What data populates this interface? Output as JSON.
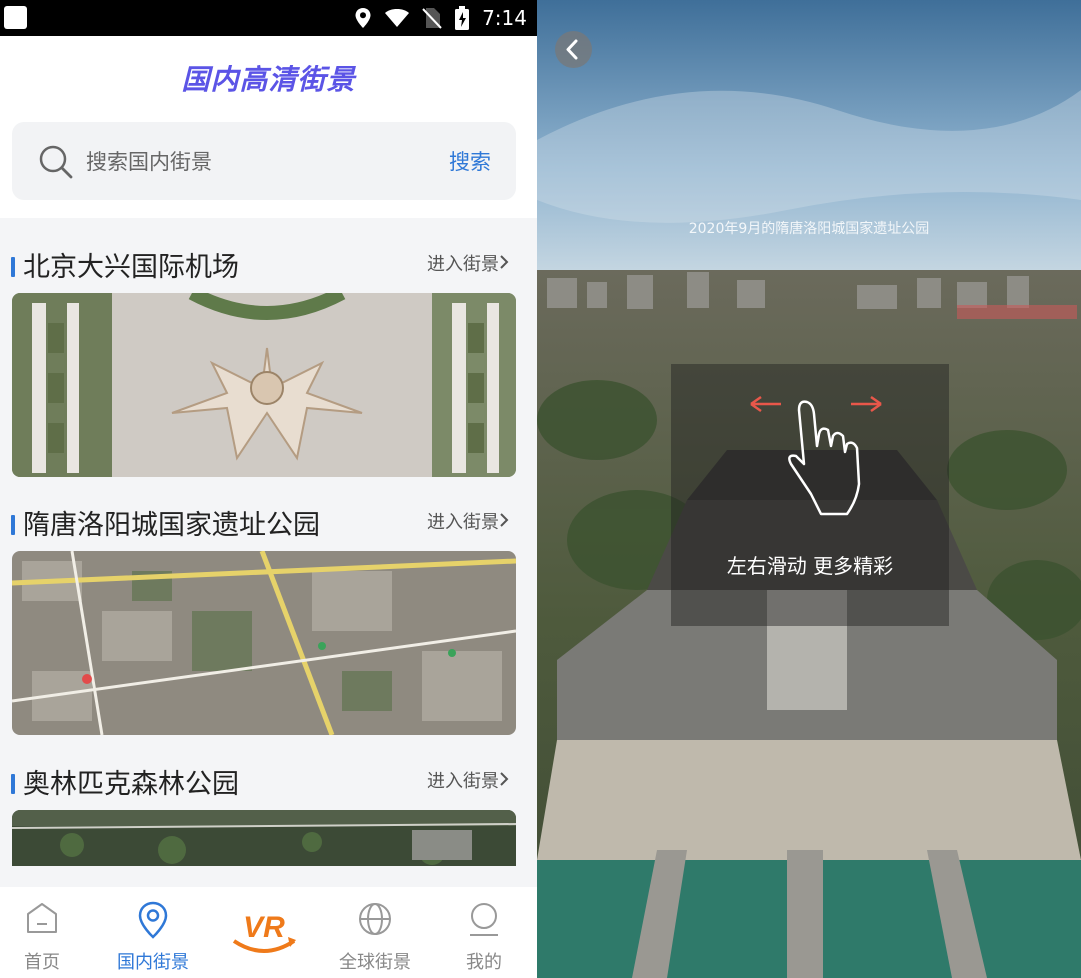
{
  "status_bar": {
    "time": "7:14"
  },
  "app": {
    "title": "国内高清街景"
  },
  "search": {
    "placeholder": "搜索国内街景",
    "button": "搜索"
  },
  "sections": [
    {
      "title": "北京大兴国际机场",
      "enter": "进入街景"
    },
    {
      "title": "隋唐洛阳城国家遗址公园",
      "enter": "进入街景"
    },
    {
      "title": "奥林匹克森林公园",
      "enter": "进入街景"
    }
  ],
  "bottom_nav": [
    {
      "label": "首页",
      "icon": "home-icon"
    },
    {
      "label": "国内街景",
      "icon": "location-pin-icon",
      "active": true
    },
    {
      "label": "",
      "icon": "vr-logo-icon"
    },
    {
      "label": "全球街景",
      "icon": "globe-icon"
    },
    {
      "label": "我的",
      "icon": "user-icon"
    }
  ],
  "pano": {
    "caption": "2020年9月的隋唐洛阳城国家遗址公园",
    "hint": "左右滑动 更多精彩"
  },
  "colors": {
    "accent": "#2f78d7",
    "title_gradient": "#5b54e6",
    "vr_orange": "#ef7a1a"
  }
}
